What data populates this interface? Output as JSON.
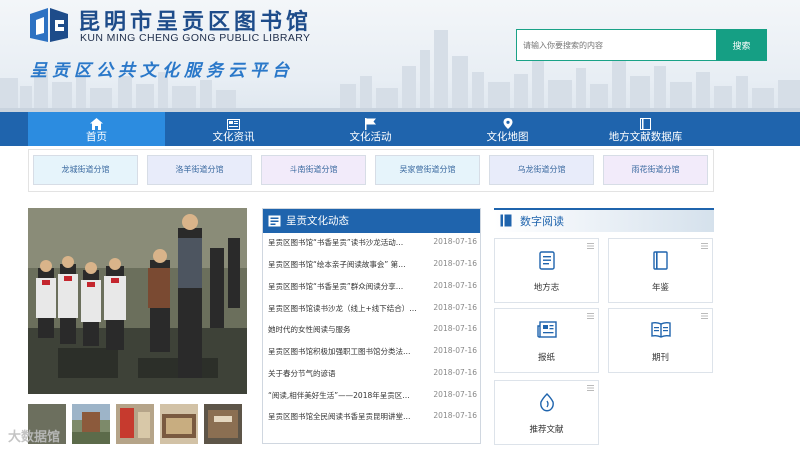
{
  "header": {
    "title_cn": "昆明市呈贡区图书馆",
    "title_en": "KUN MING CHENG GONG PUBLIC LIBRARY",
    "platform": "呈贡区公共文化服务云平台",
    "search_placeholder": "请输入你要搜索的内容",
    "search_button": "搜索"
  },
  "nav": {
    "items": [
      {
        "label": "首页",
        "icon": "home-icon"
      },
      {
        "label": "文化资讯",
        "icon": "newspaper-icon"
      },
      {
        "label": "文化活动",
        "icon": "flag-icon"
      },
      {
        "label": "文化地图",
        "icon": "map-pin-icon"
      },
      {
        "label": "地方文献数据库",
        "icon": "book-icon"
      }
    ]
  },
  "branches": [
    {
      "label": "龙城街道分馆",
      "color": "#e6f4fb"
    },
    {
      "label": "洛羊街道分馆",
      "color": "#e8ecfa"
    },
    {
      "label": "斗南街道分馆",
      "color": "#f2ebfa"
    },
    {
      "label": "吴家营街道分馆",
      "color": "#e6f4fb"
    },
    {
      "label": "乌龙街道分馆",
      "color": "#e8ecfa"
    },
    {
      "label": "雨花街道分馆",
      "color": "#f2ebfa"
    }
  ],
  "watermark": "大数据馆",
  "news": {
    "title": "呈贡文化动态",
    "items": [
      {
        "text": "呈贡区图书馆“书香呈贡”读书沙龙活动…",
        "date": "2018-07-16"
      },
      {
        "text": "呈贡区图书馆“绘本亲子阅读故事会” 第…",
        "date": "2018-07-16"
      },
      {
        "text": "呈贡区图书馆“书香呈贡”群众阅读分享…",
        "date": "2018-07-16"
      },
      {
        "text": "呈贡区图书馆读书沙龙（线上+线下结合）…",
        "date": "2018-07-16"
      },
      {
        "text": "她时代的女性阅读与服务",
        "date": "2018-07-16"
      },
      {
        "text": "呈贡区图书馆积极加强职工图书馆分类法…",
        "date": "2018-07-16"
      },
      {
        "text": "关于春分节气的谚语",
        "date": "2018-07-16"
      },
      {
        "text": "“阅读,相伴美好生活”——2018年呈贡区…",
        "date": "2018-07-16"
      },
      {
        "text": "呈贡区图书馆全民阅读书香呈贡昆明讲堂…",
        "date": "2018-07-16"
      }
    ]
  },
  "digital": {
    "title": "数字阅读",
    "tiles": [
      {
        "label": "地方志",
        "icon": "local-chronicle-icon"
      },
      {
        "label": "年鉴",
        "icon": "yearbook-icon"
      },
      {
        "label": "报纸",
        "icon": "newspaper-icon"
      },
      {
        "label": "期刊",
        "icon": "journal-icon"
      },
      {
        "label": "推荐文献",
        "icon": "recommend-icon"
      }
    ]
  },
  "colors": {
    "nav": "#1f64ad",
    "nav_active": "#2c8ce0",
    "search_button": "#159f84",
    "brand": "#1e4c8a"
  }
}
